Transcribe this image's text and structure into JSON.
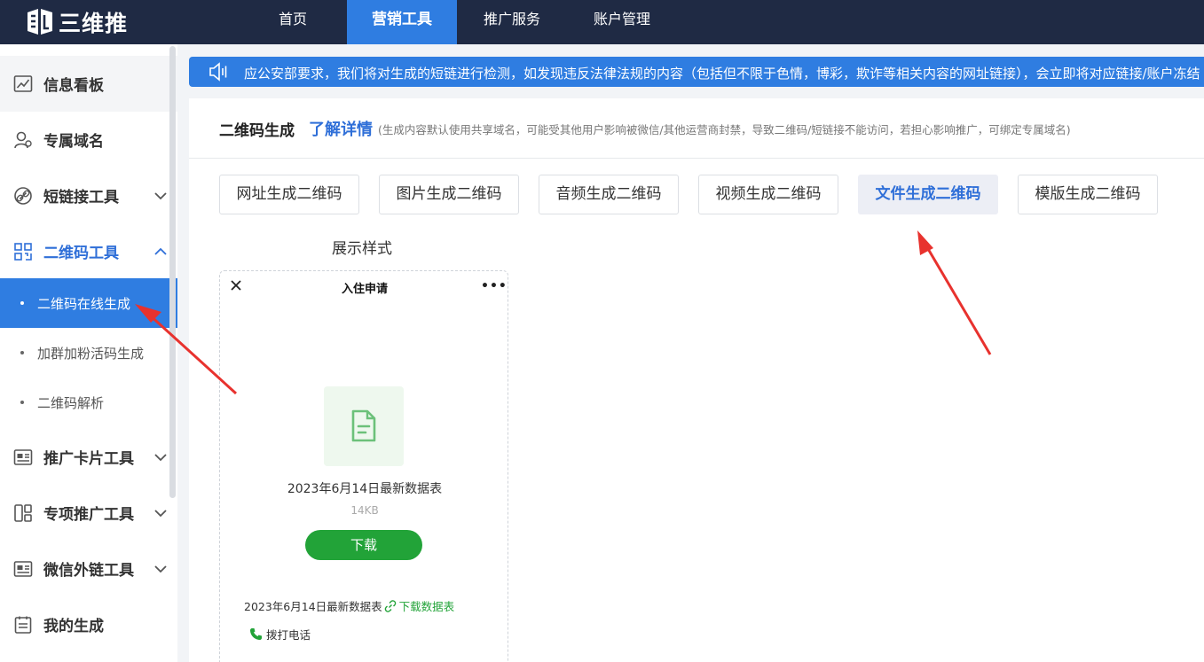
{
  "brand": {
    "name": "三维推"
  },
  "nav": [
    {
      "label": "首页",
      "active": false
    },
    {
      "label": "营销工具",
      "active": true
    },
    {
      "label": "推广服务",
      "active": false
    },
    {
      "label": "账户管理",
      "active": false
    }
  ],
  "sidebar": {
    "items": [
      {
        "label": "信息看板",
        "icon": "chart-icon"
      },
      {
        "label": "专属域名",
        "icon": "user-icon"
      },
      {
        "label": "短链接工具",
        "icon": "link-icon"
      },
      {
        "label": "二维码工具",
        "icon": "qrcode-icon"
      },
      {
        "label": "推广卡片工具",
        "icon": "card-icon"
      },
      {
        "label": "专项推广工具",
        "icon": "mobile-icon"
      },
      {
        "label": "微信外链工具",
        "icon": "card-icon"
      },
      {
        "label": "我的生成",
        "icon": "list-icon"
      }
    ],
    "sub_items": [
      {
        "label": "二维码在线生成",
        "active": true
      },
      {
        "label": "加群加粉活码生成",
        "active": false
      },
      {
        "label": "二维码解析",
        "active": false
      }
    ]
  },
  "notice": {
    "text": "应公安部要求，我们将对生成的短链进行检测，如发现违反法律法规的内容（包括但不限于色情，博彩，欺诈等相关内容的网址链接），会立即将对应链接/账户冻结"
  },
  "main": {
    "title": "二维码生成",
    "learn_more": "了解详情",
    "subnote": "(生成内容默认使用共享域名，可能受其他用户影响被微信/其他运营商封禁，导致二维码/短链接不能访问，若担心影响推广，可绑定专属域名)",
    "tabs": [
      {
        "label": "网址生成二维码",
        "active": false
      },
      {
        "label": "图片生成二维码",
        "active": false
      },
      {
        "label": "音频生成二维码",
        "active": false
      },
      {
        "label": "视频生成二维码",
        "active": false
      },
      {
        "label": "文件生成二维码",
        "active": true
      },
      {
        "label": "模版生成二维码",
        "active": false
      }
    ],
    "style_label": "展示样式"
  },
  "preview": {
    "title": "入住申请",
    "more": "•••",
    "file_name": "2023年6月14日最新数据表",
    "file_size": "14KB",
    "download_label": "下载",
    "footer_text": "2023年6月14日最新数据表",
    "footer_link": "下载数据表",
    "call_label": "拨打电话"
  },
  "colors": {
    "topbar": "#1f2a44",
    "accent": "#2f7de1",
    "link": "#2f6fd8",
    "green": "#22a338",
    "arrow": "#e8322e"
  }
}
